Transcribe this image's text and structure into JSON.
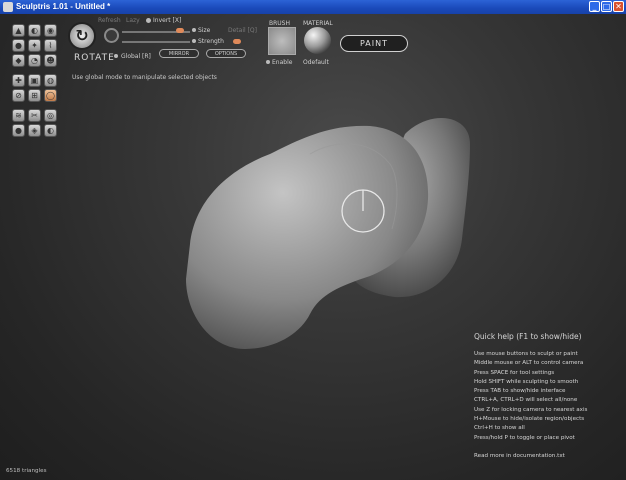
{
  "window": {
    "title": "Sculptris 1.01 - Untitled *",
    "minimize_glyph": "_",
    "maximize_glyph": "□",
    "close_glyph": "✕"
  },
  "toolbar": {
    "tool_glyphs": [
      "▲",
      "◐",
      "◉",
      "●",
      "✦",
      "⌇",
      "◆",
      "◔",
      "☻",
      "✚",
      "▣",
      "◍",
      "⊘",
      "⊞",
      "◯",
      "≋",
      "✂",
      "◎",
      "●",
      "◈",
      "◐",
      "◑"
    ],
    "active_tool_name": "ROTATE",
    "refresh_label": "Refresh",
    "lazy_label": "Lazy",
    "invert_label": "Invert [X]",
    "size_label": "Size",
    "detail_label": "Detail [Q]",
    "strength_label": "Strength",
    "global_label": "Global [R]",
    "mirror_label": "MIRROR",
    "options_label": "OPTIONS",
    "brush_label": "BRUSH",
    "brush_enable_label": "Enable",
    "material_label": "MATERIAL",
    "material_name": "Odefault",
    "paint_label": "PAINT"
  },
  "status_message": "Use global mode to manipulate selected objects",
  "quick_help": {
    "title": "Quick help (F1 to show/hide)",
    "lines": [
      "Use mouse buttons to sculpt or paint",
      "Middle mouse or ALT to control camera",
      "Press SPACE for tool settings",
      "Hold SHIFT while sculpting to smooth",
      "Press TAB to show/hide interface",
      "CTRL+A, CTRL+D will select all/none",
      "Use Z for locking camera to nearest axis",
      "H+Mouse to hide/isolate region/objects",
      "Ctrl+H to show all",
      "Press/hold P to toggle or place pivot"
    ],
    "footer": "Read more in documentation.txt"
  },
  "triangle_count": "6518 triangles",
  "colors": {
    "titlebar": "#1a49b9",
    "background": "#2a2a2a",
    "accent_knob": "#e08a5a",
    "text": "#d6d6d6"
  }
}
